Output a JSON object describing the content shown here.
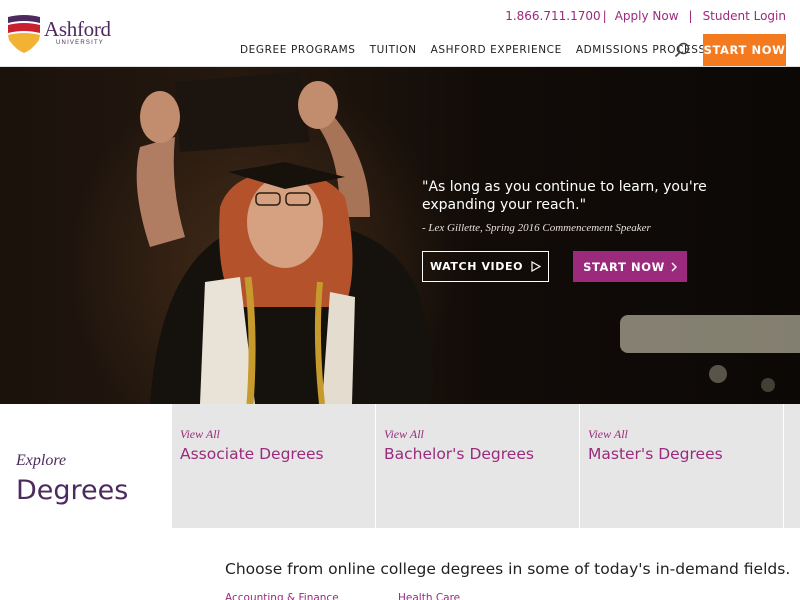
{
  "header": {
    "logo": {
      "name": "Ashford",
      "subtitle": "UNIVERSITY"
    },
    "phone": "1.866.711.1700",
    "apply_label": "Apply Now",
    "login_label": "Student Login",
    "nav": [
      {
        "label": "DEGREE PROGRAMS"
      },
      {
        "label": "TUITION"
      },
      {
        "label": "ASHFORD EXPERIENCE"
      },
      {
        "label": "ADMISSIONS PROCESS"
      }
    ],
    "search_icon": "search-icon",
    "start_label": "START NOW"
  },
  "hero": {
    "quote": "\"As long as you continue to learn, you're expanding your reach.\"",
    "attribution": "- Lex Gillette, Spring 2016 Commencement Speaker",
    "watch_label": "WATCH VIDEO",
    "watch_icon": "play-icon",
    "start_label": "START NOW",
    "start_icon": "chevron-right-icon"
  },
  "explore": {
    "label": "Explore",
    "title": "Degrees",
    "cards": [
      {
        "view_all": "View All",
        "title": "Associate Degrees"
      },
      {
        "view_all": "View All",
        "title": "Bachelor's Degrees"
      },
      {
        "view_all": "View All",
        "title": "Master's Degrees"
      }
    ]
  },
  "bottom": {
    "intro": "Choose from online college degrees in some of today's in-demand fields.",
    "fields": [
      "Accounting & Finance",
      "Health Care"
    ]
  },
  "colors": {
    "brand_purple": "#4d2a5e",
    "accent_magenta": "#9b2a7d",
    "cta_orange": "#f47a20",
    "card_grey": "#e6e6e6"
  }
}
